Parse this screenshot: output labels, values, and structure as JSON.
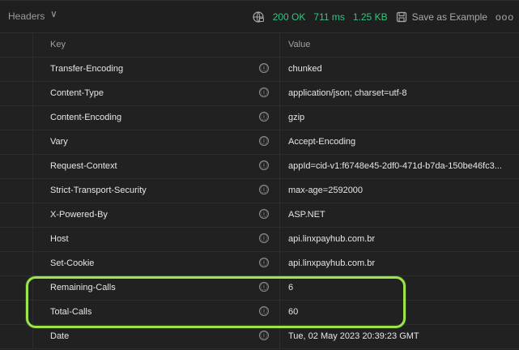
{
  "header": {
    "title": "Headers",
    "status": "200 OK",
    "time": "711 ms",
    "size": "1.25 KB",
    "save_label": "Save as Example",
    "more": "ooo"
  },
  "table": {
    "columns": {
      "key": "Key",
      "value": "Value"
    },
    "rows": [
      {
        "key": "Transfer-Encoding",
        "value": "chunked"
      },
      {
        "key": "Content-Type",
        "value": "application/json; charset=utf-8"
      },
      {
        "key": "Content-Encoding",
        "value": "gzip"
      },
      {
        "key": "Vary",
        "value": "Accept-Encoding"
      },
      {
        "key": "Request-Context",
        "value": "appId=cid-v1:f6748e45-2df0-471d-b7da-150be46fc3..."
      },
      {
        "key": "Strict-Transport-Security",
        "value": "max-age=2592000"
      },
      {
        "key": "X-Powered-By",
        "value": "ASP.NET"
      },
      {
        "key": "Host",
        "value": "api.linxpayhub.com.br"
      },
      {
        "key": "Set-Cookie",
        "value": "api.linxpayhub.com.br"
      },
      {
        "key": "Remaining-Calls",
        "value": "6"
      },
      {
        "key": "Total-Calls",
        "value": "60"
      },
      {
        "key": "Date",
        "value": "Tue, 02 May 2023 20:39:23 GMT"
      }
    ]
  },
  "icons": {
    "info": "ⓘ",
    "chevron": "∨"
  },
  "colors": {
    "highlight": "#9be44a",
    "status": "#33c481"
  }
}
